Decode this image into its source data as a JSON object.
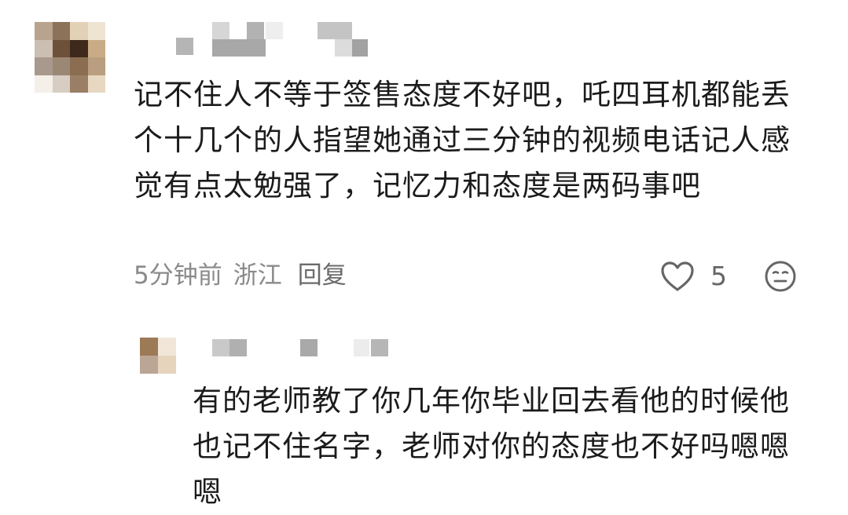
{
  "comments": [
    {
      "text": "记不住人不等于签售态度不好吧，吒四耳机都能丢个十几个的人指望她通过三分钟的视频电话记人感觉有点太勉强了，记忆力和态度是两码事吧",
      "time": "5分钟前",
      "location": "浙江",
      "reply_label": "回复",
      "like_count": "5"
    },
    {
      "text": "有的老师教了你几年你毕业回去看他的时候他也记不住名字，老师对你的态度也不好吗嗯嗯嗯"
    }
  ],
  "icons": {
    "like": "heart-outline-icon",
    "dislike": "meh-face-icon"
  },
  "colors": {
    "text": "#1b1b1b",
    "meta": "#8a8a8a",
    "icon": "#666666"
  }
}
